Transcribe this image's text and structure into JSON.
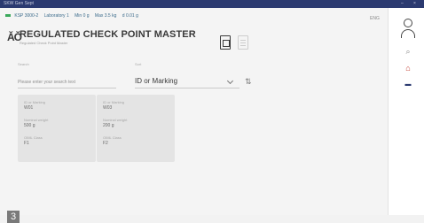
{
  "window": {
    "title": "SKW Gen Sept",
    "controls": "–  ×"
  },
  "status": {
    "balance": "KSP 3000-2",
    "room": "Laboratory 1",
    "min": "Min 0 g",
    "max": "Max 3.5 kg",
    "d": "d 0.01 g",
    "lang": "ENG"
  },
  "header": {
    "app_icon": "ĂŎ",
    "title": "REGULATED CHECK POINT MASTER",
    "subtitle": "Regulated Check Point Master"
  },
  "search": {
    "label": "Search",
    "placeholder": "Please enter your search text"
  },
  "sort": {
    "label": "Sort",
    "value": "ID or Marking"
  },
  "cards": [
    {
      "id_label": "ID or Marking",
      "id": "W01",
      "weight_label": "Nominal weight",
      "weight": "500 g",
      "class_label": "OIML Class",
      "class": "F1"
    },
    {
      "id_label": "ID or Marking",
      "id": "W03",
      "weight_label": "Nominal weight",
      "weight": "200 g",
      "class_label": "OIML Class",
      "class": "F2"
    }
  ],
  "page_badge": "3",
  "colors": {
    "titlebar": "#2b3a70",
    "status_ok": "#3aa85b",
    "accent": "#3a6a8a"
  },
  "icons": [
    "user-icon",
    "clear-filter-icon",
    "home-icon",
    "device-icon",
    "report-icon",
    "list-icon",
    "sort-icon",
    "chevron-down-icon"
  ]
}
